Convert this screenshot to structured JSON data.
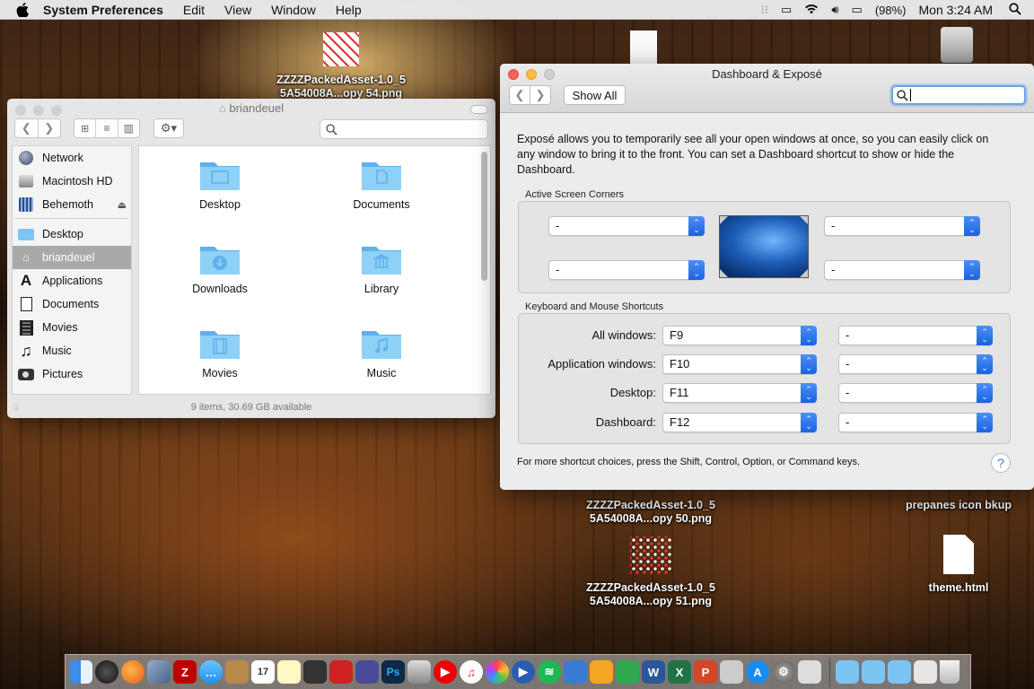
{
  "menubar": {
    "app_name": "System Preferences",
    "menus": [
      "Edit",
      "View",
      "Window",
      "Help"
    ],
    "battery": "(98%)",
    "clock": "Mon 3:24 AM"
  },
  "desktop": {
    "icons": [
      {
        "line1": "ZZZZPackedAsset-1.0_5",
        "line2": "5A54008A...opy 54.png"
      },
      {
        "line1": "ZZZZPackedAsset-1.0_5",
        "line2": "5A54008A...opy 50.png"
      },
      {
        "line1": "ZZZZPackedAsset-1.0_5",
        "line2": "5A54008A...opy 51.png"
      },
      {
        "line1": "prepanes icon bkup",
        "line2": ""
      },
      {
        "line1": "theme.html",
        "line2": ""
      }
    ]
  },
  "finder": {
    "title": "briandeuel",
    "sidebar": [
      {
        "label": "Network",
        "icon": "network-globe-icon"
      },
      {
        "label": "Macintosh HD",
        "icon": "hard-drive-icon"
      },
      {
        "label": "Behemoth",
        "icon": "server-icon"
      },
      {
        "label": "Desktop",
        "icon": "desktop-folder-icon"
      },
      {
        "label": "briandeuel",
        "icon": "home-icon",
        "selected": true
      },
      {
        "label": "Applications",
        "icon": "applications-icon"
      },
      {
        "label": "Documents",
        "icon": "documents-icon"
      },
      {
        "label": "Movies",
        "icon": "film-icon"
      },
      {
        "label": "Music",
        "icon": "music-note-icon"
      },
      {
        "label": "Pictures",
        "icon": "camera-icon"
      }
    ],
    "items": [
      {
        "label": "Desktop",
        "icon": "desktop-folder-icon"
      },
      {
        "label": "Documents",
        "icon": "documents-folder-icon"
      },
      {
        "label": "Downloads",
        "icon": "downloads-folder-icon"
      },
      {
        "label": "Library",
        "icon": "library-folder-icon"
      },
      {
        "label": "Movies",
        "icon": "movies-folder-icon"
      },
      {
        "label": "Music",
        "icon": "music-folder-icon"
      }
    ],
    "status": "9 items, 30.69 GB available"
  },
  "prefs": {
    "title": "Dashboard & Exposé",
    "show_all": "Show All",
    "description": "Exposé allows you to temporarily see all your open windows at once, so you can easily click on any window to bring it to the front. You can set a Dashboard shortcut to show or hide the Dashboard.",
    "corners_label": "Active Screen Corners",
    "corners": [
      "-",
      "-",
      "-",
      "-"
    ],
    "shortcuts_label": "Keyboard and Mouse Shortcuts",
    "shortcuts": [
      {
        "label": "All windows:",
        "key": "F9",
        "mouse": "-"
      },
      {
        "label": "Application windows:",
        "key": "F10",
        "mouse": "-"
      },
      {
        "label": "Desktop:",
        "key": "F11",
        "mouse": "-"
      },
      {
        "label": "Dashboard:",
        "key": "F12",
        "mouse": "-"
      }
    ],
    "footer": "For more shortcut choices, press the Shift, Control, Option, or Command keys.",
    "help": "?"
  },
  "colors": {
    "close": "#fc605c",
    "minimize": "#fdbc40",
    "folder": "#7cc4f2",
    "accent": "#1a62e0"
  }
}
